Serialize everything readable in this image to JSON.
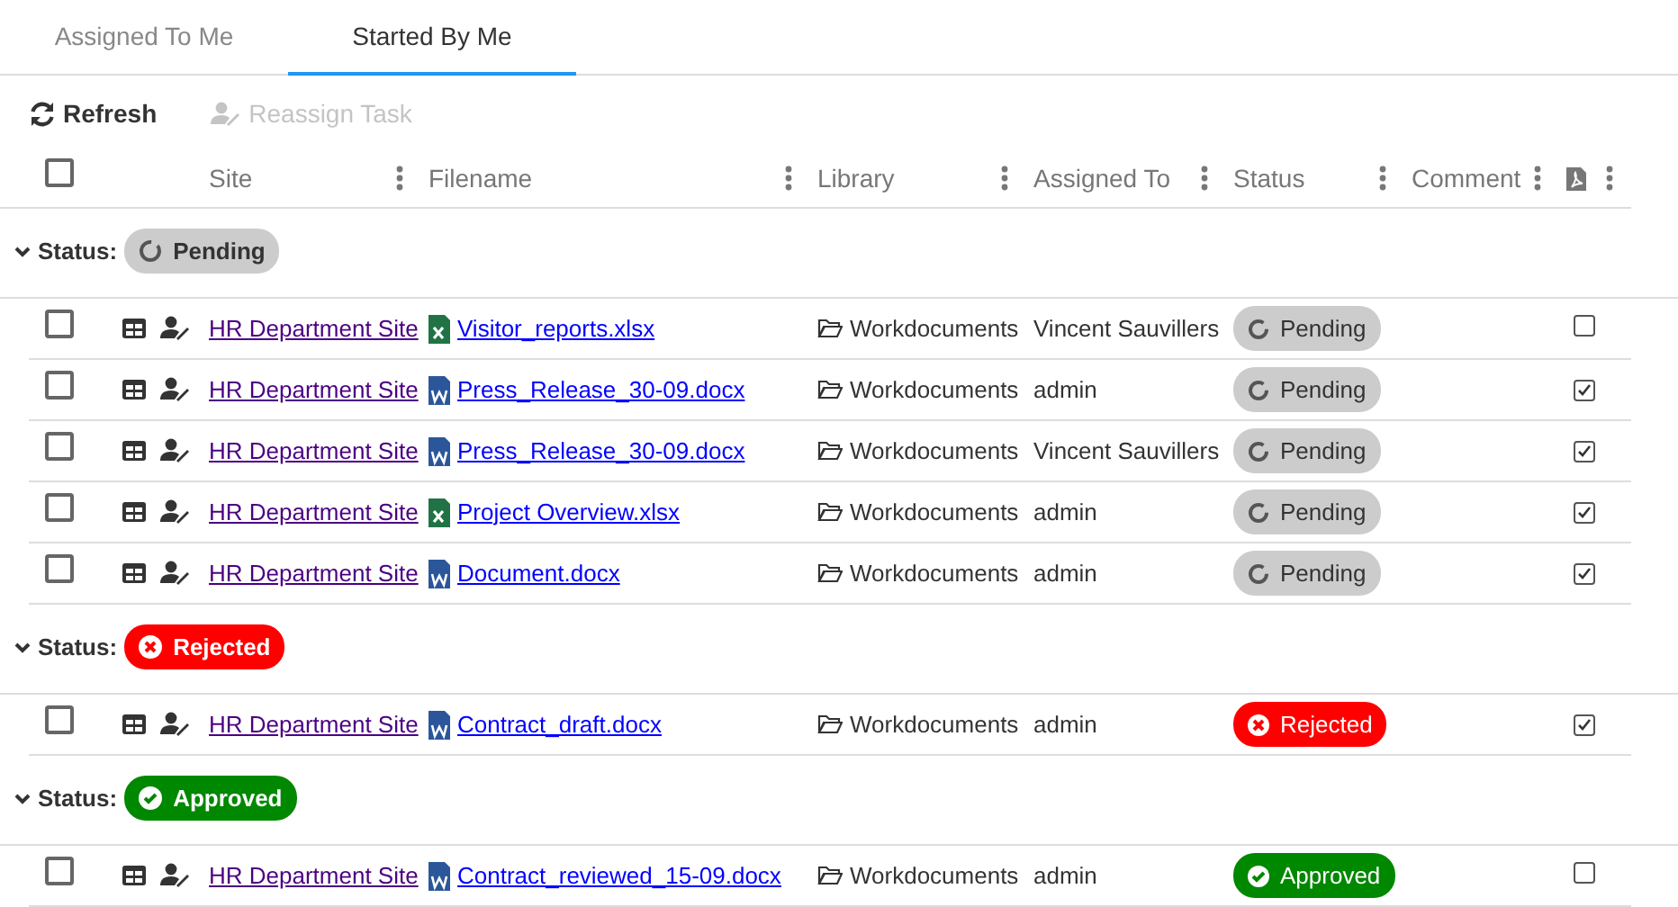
{
  "tabs": [
    {
      "label": "Assigned To Me",
      "selected": false
    },
    {
      "label": "Started By Me",
      "selected": true
    }
  ],
  "toolbar": [
    {
      "label": "Refresh",
      "kind": "refresh",
      "disabled": false
    },
    {
      "label": "Reassign Task",
      "kind": "reassign",
      "disabled": true
    }
  ],
  "table": {
    "select_all": {
      "checked": false
    },
    "columns": [
      {
        "label": "Site"
      },
      {
        "label": "Filename"
      },
      {
        "label": "Library"
      },
      {
        "label": "Assigned To"
      },
      {
        "label": "Status"
      },
      {
        "label": "Comment"
      },
      {
        "kind": "pdf"
      }
    ],
    "groups": [
      {
        "label": "Status:",
        "expanded": true,
        "status": {
          "kind": "pending",
          "label": "Pending"
        },
        "rows": [
          {
            "checked": false,
            "site": "HR Department Site",
            "file_icon": {
              "kind": "excel"
            },
            "filename": "Visitor_reports.xlsx",
            "library": "Workdocuments",
            "assigned_to": "Vincent Sauvillers",
            "status": {
              "kind": "pending",
              "label": "Pending"
            },
            "pdf": false
          },
          {
            "checked": false,
            "site": "HR Department Site",
            "file_icon": {
              "kind": "word"
            },
            "filename": "Press_Release_30-09.docx",
            "library": "Workdocuments",
            "assigned_to": "admin",
            "status": {
              "kind": "pending",
              "label": "Pending"
            },
            "pdf": true
          },
          {
            "checked": false,
            "site": "HR Department Site",
            "file_icon": {
              "kind": "word"
            },
            "filename": "Press_Release_30-09.docx",
            "library": "Workdocuments",
            "assigned_to": "Vincent Sauvillers",
            "status": {
              "kind": "pending",
              "label": "Pending"
            },
            "pdf": true
          },
          {
            "checked": false,
            "site": "HR Department Site",
            "file_icon": {
              "kind": "excel"
            },
            "filename": "Project Overview.xlsx",
            "library": "Workdocuments",
            "assigned_to": "admin",
            "status": {
              "kind": "pending",
              "label": "Pending"
            },
            "pdf": true
          },
          {
            "checked": false,
            "site": "HR Department Site",
            "file_icon": {
              "kind": "word"
            },
            "filename": "Document.docx",
            "library": "Workdocuments",
            "assigned_to": "admin",
            "status": {
              "kind": "pending",
              "label": "Pending"
            },
            "pdf": true
          }
        ]
      },
      {
        "label": "Status:",
        "expanded": true,
        "status": {
          "kind": "rejected",
          "label": "Rejected"
        },
        "rows": [
          {
            "checked": false,
            "site": "HR Department Site",
            "file_icon": {
              "kind": "word"
            },
            "filename": "Contract_draft.docx",
            "library": "Workdocuments",
            "assigned_to": "admin",
            "status": {
              "kind": "rejected",
              "label": "Rejected"
            },
            "pdf": true
          }
        ]
      },
      {
        "label": "Status:",
        "expanded": true,
        "status": {
          "kind": "approved",
          "label": "Approved"
        },
        "rows": [
          {
            "checked": false,
            "site": "HR Department Site",
            "file_icon": {
              "kind": "word"
            },
            "filename": "Contract_reviewed_15-09.docx",
            "library": "Workdocuments",
            "assigned_to": "admin",
            "status": {
              "kind": "approved",
              "label": "Approved"
            },
            "pdf": false
          }
        ]
      }
    ]
  }
}
